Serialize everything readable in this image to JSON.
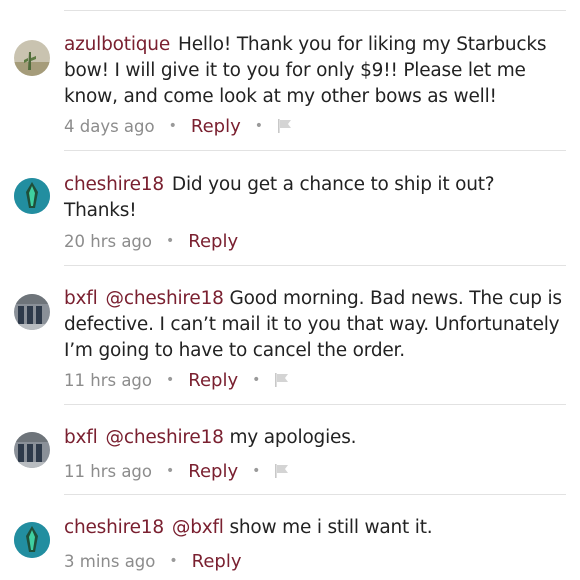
{
  "comments": [
    {
      "user": "azulbotique",
      "mention": "",
      "text": "Hello! Thank you for liking my Starbucks bow! I will give it to you for only $9!! Please let me know, and come look at my other bows as well!",
      "time": "4 days ago",
      "reply": "Reply",
      "flag_icon": "flag-icon"
    },
    {
      "user": "cheshire18",
      "mention": "",
      "text": "Did you get a chance to ship it out? Thanks!",
      "time": "20 hrs ago",
      "reply": "Reply"
    },
    {
      "user": "bxfl",
      "mention": "@cheshire18",
      "text": "Good morning.  Bad news. The cup is defective. I can’t mail it to you that way. Unfortunately I’m going to have to cancel the order.",
      "time": "11 hrs ago",
      "reply": "Reply",
      "flag_icon": "flag-icon"
    },
    {
      "user": "bxfl",
      "mention": "@cheshire18",
      "text": "my apologies.",
      "time": "11 hrs ago",
      "reply": "Reply",
      "flag_icon": "flag-icon"
    },
    {
      "user": "cheshire18",
      "mention": "@bxfl",
      "text": "show me i still want it.",
      "time": "3 mins ago",
      "reply": "Reply"
    }
  ],
  "colors": {
    "username": "#7a2030",
    "meta": "#8c8c8c",
    "divider": "#e2e2e2"
  }
}
